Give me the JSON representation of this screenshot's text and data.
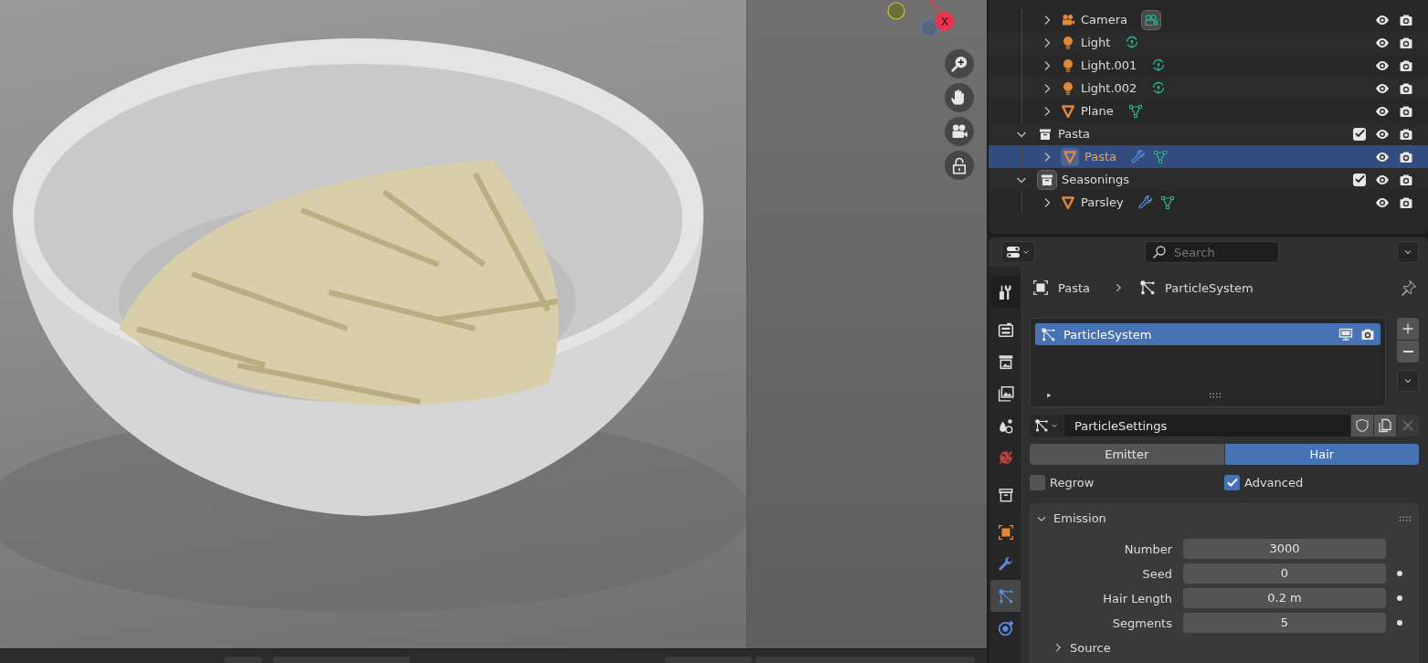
{
  "viewport": {
    "gizmo_axis": "X"
  },
  "outliner": {
    "rows": [
      {
        "name": "Camera",
        "kind": "camera",
        "expanded": false,
        "selected": false,
        "icon_highlight": false,
        "extras": [
          {
            "kind": "camera_data",
            "highlight": true
          }
        ]
      },
      {
        "name": "Light",
        "kind": "light",
        "expanded": false,
        "selected": false,
        "icon_highlight": false,
        "extras": [
          {
            "kind": "light_data",
            "highlight": false
          }
        ]
      },
      {
        "name": "Light.001",
        "kind": "light",
        "expanded": false,
        "selected": false,
        "icon_highlight": false,
        "extras": [
          {
            "kind": "light_data",
            "highlight": false
          }
        ]
      },
      {
        "name": "Light.002",
        "kind": "light",
        "expanded": false,
        "selected": false,
        "icon_highlight": false,
        "extras": [
          {
            "kind": "light_data",
            "highlight": false
          }
        ]
      },
      {
        "name": "Plane",
        "kind": "mesh",
        "expanded": false,
        "selected": false,
        "icon_highlight": false,
        "extras": [
          {
            "kind": "mesh_data",
            "highlight": false
          }
        ]
      }
    ],
    "collections": [
      {
        "name": "Pasta",
        "expanded": true,
        "checked": true,
        "icon_highlight": false,
        "children": [
          {
            "name": "Pasta",
            "kind": "mesh",
            "expanded": false,
            "selected": true,
            "icon_highlight": true,
            "extras": [
              {
                "kind": "wrench",
                "highlight": false
              },
              {
                "kind": "mesh_data",
                "highlight": false
              }
            ]
          }
        ]
      },
      {
        "name": "Seasonings",
        "expanded": true,
        "checked": true,
        "icon_highlight": true,
        "children": [
          {
            "name": "Parsley",
            "kind": "mesh",
            "expanded": false,
            "selected": false,
            "icon_highlight": false,
            "extras": [
              {
                "kind": "wrench",
                "highlight": false
              },
              {
                "kind": "mesh_data",
                "highlight": false
              }
            ]
          }
        ]
      }
    ]
  },
  "properties": {
    "search": {
      "placeholder": "Search"
    },
    "tabs": [
      {
        "kind": "tool",
        "selected": false
      },
      {
        "kind": "render",
        "selected": false
      },
      {
        "kind": "output",
        "selected": false
      },
      {
        "kind": "view_layer",
        "selected": false
      },
      {
        "kind": "scene",
        "selected": false
      },
      {
        "kind": "world",
        "selected": false
      },
      {
        "kind": "collection",
        "selected": false
      },
      {
        "kind": "object",
        "selected": false
      },
      {
        "kind": "modifiers",
        "selected": false
      },
      {
        "kind": "particles",
        "selected": true
      },
      {
        "kind": "physics",
        "selected": false
      }
    ],
    "breadcrumb": [
      {
        "kind": "object",
        "label": "Pasta"
      },
      {
        "kind": "particles",
        "label": "ParticleSystem"
      }
    ],
    "systems": [
      {
        "name": "ParticleSystem",
        "selected": true
      }
    ],
    "settings": {
      "value": "ParticleSettings"
    },
    "type_toggle": [
      {
        "label": "Emitter",
        "selected": false
      },
      {
        "label": "Hair",
        "selected": true
      }
    ],
    "options": [
      {
        "label": "Regrow",
        "checked": false
      },
      {
        "label": "Advanced",
        "checked": true
      }
    ],
    "panels": [
      {
        "title": "Emission",
        "expanded": true,
        "fields": [
          {
            "label": "Number",
            "value": "3000",
            "keyframe_dot": false
          },
          {
            "label": "Seed",
            "value": "0",
            "keyframe_dot": true
          },
          {
            "label": "Hair Length",
            "value": "0.2 m",
            "keyframe_dot": true
          },
          {
            "label": "Segments",
            "value": "5",
            "keyframe_dot": true
          }
        ]
      },
      {
        "title": "Source",
        "expanded": false
      }
    ]
  }
}
